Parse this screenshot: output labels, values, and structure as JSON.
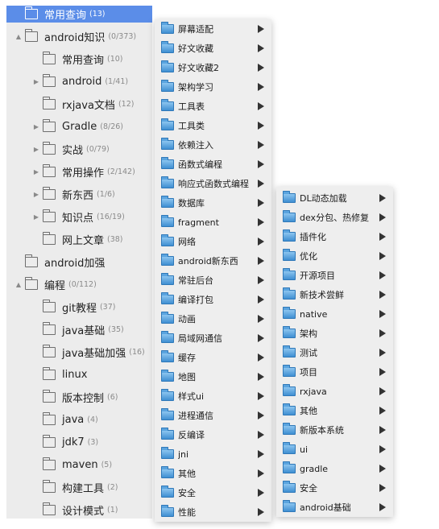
{
  "sidebar": {
    "items": [
      {
        "label": "常用查询",
        "count": "(13)",
        "level": 0,
        "disclosure": "",
        "selected": true
      },
      {
        "label": "android知识",
        "count": "(0/373)",
        "level": 0,
        "disclosure": "▲",
        "selected": false
      },
      {
        "label": "常用查询",
        "count": "(10)",
        "level": 1,
        "disclosure": "",
        "selected": false
      },
      {
        "label": "android",
        "count": "(1/41)",
        "level": 1,
        "disclosure": "▶",
        "selected": false
      },
      {
        "label": "rxjava文档",
        "count": "(12)",
        "level": 1,
        "disclosure": "",
        "selected": false
      },
      {
        "label": "Gradle",
        "count": "(8/26)",
        "level": 1,
        "disclosure": "▶",
        "selected": false
      },
      {
        "label": "实战",
        "count": "(0/79)",
        "level": 1,
        "disclosure": "▶",
        "selected": false
      },
      {
        "label": "常用操作",
        "count": "(2/142)",
        "level": 1,
        "disclosure": "▶",
        "selected": false
      },
      {
        "label": "新东西",
        "count": "(1/6)",
        "level": 1,
        "disclosure": "▶",
        "selected": false
      },
      {
        "label": "知识点",
        "count": "(16/19)",
        "level": 1,
        "disclosure": "▶",
        "selected": false
      },
      {
        "label": "网上文章",
        "count": "(38)",
        "level": 1,
        "disclosure": "",
        "selected": false
      },
      {
        "label": "android加强",
        "count": "",
        "level": 0,
        "disclosure": "",
        "selected": false
      },
      {
        "label": "编程",
        "count": "(0/112)",
        "level": 0,
        "disclosure": "▲",
        "selected": false
      },
      {
        "label": "git教程",
        "count": "(37)",
        "level": 1,
        "disclosure": "",
        "selected": false
      },
      {
        "label": "java基础",
        "count": "(35)",
        "level": 1,
        "disclosure": "",
        "selected": false
      },
      {
        "label": "java基础加强",
        "count": "(16)",
        "level": 1,
        "disclosure": "",
        "selected": false
      },
      {
        "label": "linux",
        "count": "",
        "level": 1,
        "disclosure": "",
        "selected": false
      },
      {
        "label": "版本控制",
        "count": "(6)",
        "level": 1,
        "disclosure": "",
        "selected": false
      },
      {
        "label": "java",
        "count": "(4)",
        "level": 1,
        "disclosure": "",
        "selected": false
      },
      {
        "label": "jdk7",
        "count": "(3)",
        "level": 1,
        "disclosure": "",
        "selected": false
      },
      {
        "label": "maven",
        "count": "(5)",
        "level": 1,
        "disclosure": "",
        "selected": false
      },
      {
        "label": "构建工具",
        "count": "(2)",
        "level": 1,
        "disclosure": "",
        "selected": false
      },
      {
        "label": "设计模式",
        "count": "(1)",
        "level": 1,
        "disclosure": "",
        "selected": false
      }
    ]
  },
  "menu1": {
    "items": [
      {
        "label": "屏幕适配"
      },
      {
        "label": "好文收藏"
      },
      {
        "label": "好文收藏2"
      },
      {
        "label": "架构学习"
      },
      {
        "label": "工具表"
      },
      {
        "label": "工具类"
      },
      {
        "label": "依赖注入"
      },
      {
        "label": "函数式编程"
      },
      {
        "label": "响应式函数式编程"
      },
      {
        "label": "数据库"
      },
      {
        "label": "fragment"
      },
      {
        "label": "网络"
      },
      {
        "label": "android新东西"
      },
      {
        "label": "常驻后台"
      },
      {
        "label": "编译打包"
      },
      {
        "label": "动画"
      },
      {
        "label": "局域网通信"
      },
      {
        "label": "缓存"
      },
      {
        "label": "地图"
      },
      {
        "label": "样式ui"
      },
      {
        "label": "进程通信"
      },
      {
        "label": "反编译"
      },
      {
        "label": "jni"
      },
      {
        "label": "其他"
      },
      {
        "label": "安全"
      },
      {
        "label": "性能"
      }
    ]
  },
  "menu2": {
    "items": [
      {
        "label": "DL动态加载"
      },
      {
        "label": "dex分包、热修复"
      },
      {
        "label": "插件化"
      },
      {
        "label": "优化"
      },
      {
        "label": "开源项目"
      },
      {
        "label": "新技术尝鲜"
      },
      {
        "label": "native"
      },
      {
        "label": "架构"
      },
      {
        "label": "测试"
      },
      {
        "label": "项目"
      },
      {
        "label": "rxjava"
      },
      {
        "label": "其他"
      },
      {
        "label": "新版本系统"
      },
      {
        "label": "ui"
      },
      {
        "label": "gradle"
      },
      {
        "label": "安全"
      },
      {
        "label": "android基础"
      }
    ]
  },
  "icons": {
    "tree_folder": "folder-outline-icon",
    "menu_folder": "blue-folder-icon",
    "submenu": "submenu-arrow-icon"
  },
  "colors": {
    "selection": "#5b8de8",
    "sidebar_bg": "#ececec",
    "menu_bg": "#eeeeee",
    "folder_blue": "#3f8fd2"
  }
}
